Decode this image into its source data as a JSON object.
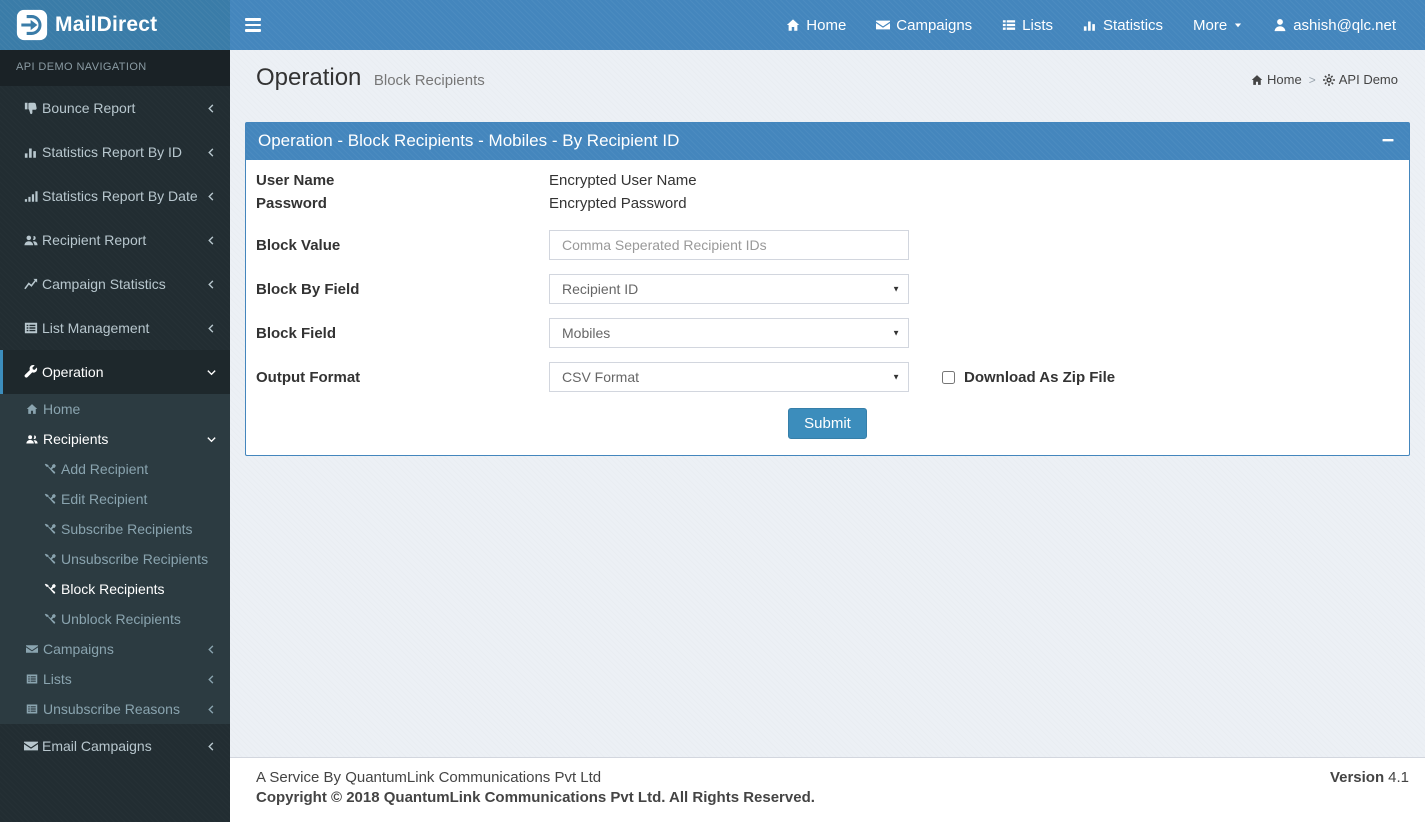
{
  "brand": {
    "logo_text": "MailDirect"
  },
  "colors": {
    "navbar": "#4486bd",
    "logo_bg": "#3a7ca8",
    "sidebar": "#222d32",
    "submenu_bg": "#2c3b41",
    "accent": "#3c8dbc",
    "content_bg": "#ecf0f5"
  },
  "navbar": {
    "items": [
      {
        "label": "Home",
        "icon": "home-icon"
      },
      {
        "label": "Campaigns",
        "icon": "envelope-icon"
      },
      {
        "label": "Lists",
        "icon": "list-icon"
      },
      {
        "label": "Statistics",
        "icon": "bar-chart-icon"
      },
      {
        "label": "More",
        "icon": "caret-down-icon"
      },
      {
        "label": "ashish@qlc.net",
        "icon": "user-icon"
      }
    ]
  },
  "sidebar": {
    "header": "API DEMO NAVIGATION",
    "top_items": [
      {
        "label": "Bounce Report",
        "icon": "thumbs-down-icon"
      },
      {
        "label": "Statistics Report By ID",
        "icon": "bar-chart-icon"
      },
      {
        "label": "Statistics Report By Date",
        "icon": "signal-icon"
      },
      {
        "label": "Recipient Report",
        "icon": "users-icon"
      },
      {
        "label": "Campaign Statistics",
        "icon": "line-chart-icon"
      },
      {
        "label": "List Management",
        "icon": "list-alt-icon"
      },
      {
        "label": "Operation",
        "icon": "wrench-icon"
      }
    ],
    "operation_submenu": [
      {
        "label": "Home",
        "icon": "home-icon"
      },
      {
        "label": "Recipients",
        "icon": "users-icon"
      },
      {
        "label": "Campaigns",
        "icon": "envelope-icon"
      },
      {
        "label": "Lists",
        "icon": "list-icon"
      },
      {
        "label": "Unsubscribe Reasons",
        "icon": "list-icon"
      }
    ],
    "recipients_submenu": [
      {
        "label": "Add Recipient",
        "icon": "tools-icon"
      },
      {
        "label": "Edit Recipient",
        "icon": "tools-icon"
      },
      {
        "label": "Subscribe Recipients",
        "icon": "tools-icon"
      },
      {
        "label": "Unsubscribe Recipients",
        "icon": "tools-icon"
      },
      {
        "label": "Block Recipients",
        "icon": "tools-icon"
      },
      {
        "label": "Unblock Recipients",
        "icon": "tools-icon"
      }
    ],
    "bottom_items": [
      {
        "label": "Email Campaigns",
        "icon": "envelope-icon"
      }
    ]
  },
  "page": {
    "title": "Operation",
    "subtitle": "Block Recipients"
  },
  "breadcrumb": {
    "home": "Home",
    "current": "API Demo"
  },
  "panel": {
    "title": "Operation - Block Recipients - Mobiles - By Recipient ID"
  },
  "form": {
    "user_name_label": "User Name",
    "user_name_value": "Encrypted User Name",
    "password_label": "Password",
    "password_value": "Encrypted Password",
    "block_value_label": "Block Value",
    "block_value_placeholder": "Comma Seperated Recipient IDs",
    "block_by_field_label": "Block By Field",
    "block_by_field_value": "Recipient ID",
    "block_field_label": "Block Field",
    "block_field_value": "Mobiles",
    "output_format_label": "Output Format",
    "output_format_value": "CSV Format",
    "zip_label": "Download As Zip File",
    "submit_label": "Submit"
  },
  "footer": {
    "service_line": "A Service By QuantumLink Communications Pvt Ltd",
    "copyright_line": "Copyright © 2018 QuantumLink Communications Pvt Ltd. All Rights Reserved.",
    "version_label": "Version",
    "version_value": "4.1"
  }
}
